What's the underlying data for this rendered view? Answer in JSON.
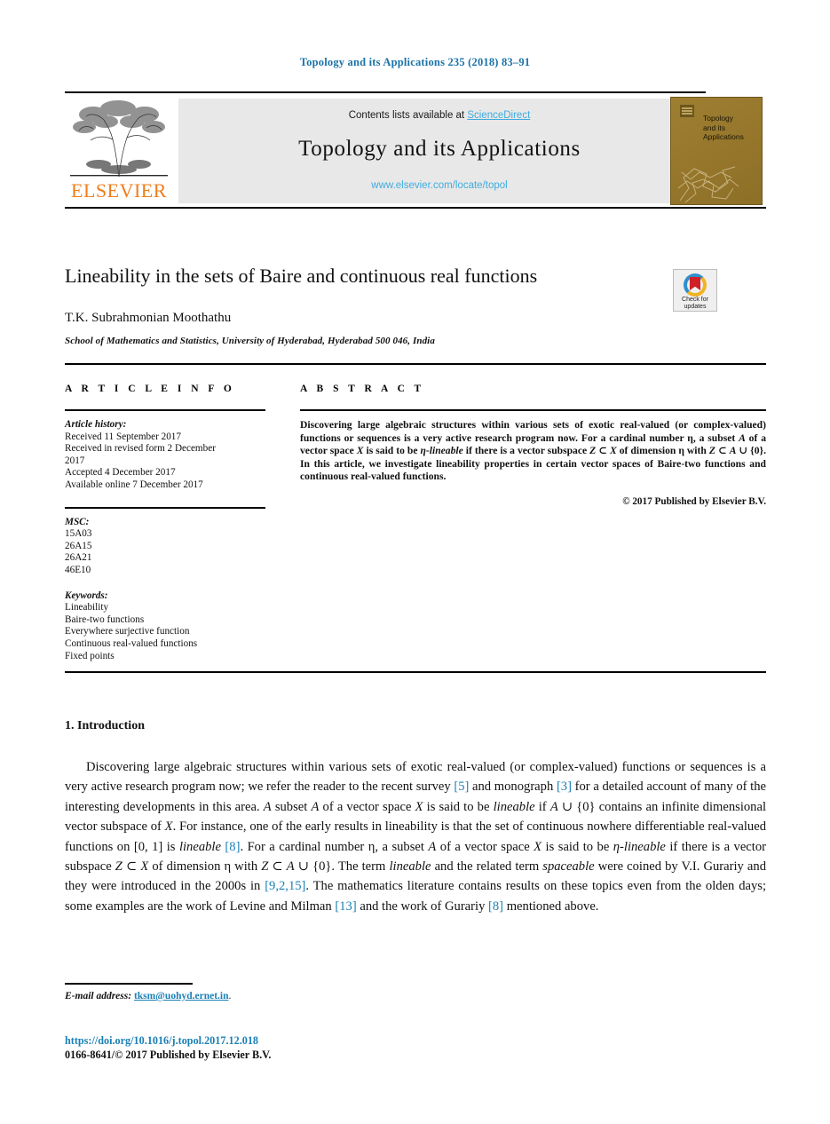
{
  "running_head": "Topology and its Applications 235 (2018) 83–91",
  "masthead": {
    "contents_prefix": "Contents lists available at ",
    "sciencedirect_label": "ScienceDirect",
    "journal_title": "Topology and its Applications",
    "journal_url": "www.elsevier.com/locate/topol",
    "publisher_word": "ELSEVIER",
    "cover_title_lines": [
      "Topology",
      "and its",
      "Applications"
    ]
  },
  "article": {
    "title": "Lineability in the sets of Baire and continuous real functions",
    "author": "T.K. Subrahmonian Moothathu",
    "affiliation": "School of Mathematics and Statistics, University of Hyderabad, Hyderabad 500 046, India",
    "crossmark_label_line1": "Check for",
    "crossmark_label_line2": "updates"
  },
  "info": {
    "heading": "A R T I C L E   I N F O",
    "history_label": "Article history:",
    "history_lines": [
      "Received 11 September 2017",
      "Received in revised form 2 December",
      "2017",
      "Accepted 4 December 2017",
      "Available online 7 December 2017"
    ],
    "msc_label": "MSC:",
    "msc_codes": [
      "15A03",
      "26A15",
      "26A21",
      "46E10"
    ],
    "keywords_label": "Keywords:",
    "keywords": [
      "Lineability",
      "Baire-two functions",
      "Everywhere surjective function",
      "Continuous real-valued functions",
      "Fixed points"
    ]
  },
  "abstract": {
    "heading": "A B S T R A C T",
    "text": "Discovering large algebraic structures within various sets of exotic real-valued (or complex-valued) functions or sequences is a very active research program now. For a cardinal number η, a subset A of a vector space X is said to be η-lineable if there is a vector subspace Z ⊂ X of dimension η with Z ⊂ A ∪ {0}. In this article, we investigate lineability properties in certain vector spaces of Baire-two functions and continuous real-valued functions.",
    "copyright": "© 2017 Published by Elsevier B.V."
  },
  "body": {
    "section_heading": "1. Introduction",
    "paragraph": "Discovering large algebraic structures within various sets of exotic real-valued (or complex-valued) functions or sequences is a very active research program now; we refer the reader to the recent survey [5] and monograph [3] for a detailed account of many of the interesting developments in this area. A subset A of a vector space X is said to be lineable if A ∪ {0} contains an infinite dimensional vector subspace of X. For instance, one of the early results in lineability is that the set of continuous nowhere differentiable real-valued functions on [0, 1] is lineable [8]. For a cardinal number η, a subset A of a vector space X is said to be η-lineable if there is a vector subspace Z ⊂ X of dimension η with Z ⊂ A ∪ {0}. The term lineable and the related term spaceable were coined by V.I. Gurariy and they were introduced in the 2000s in [9,2,15]. The mathematics literature contains results on these topics even from the olden days; some examples are the work of Levine and Milman [13] and the work of Gurariy [8] mentioned above.",
    "references_cited": [
      "5",
      "3",
      "8",
      "9,2,15",
      "13",
      "8"
    ]
  },
  "footer": {
    "email_label": "E-mail address:",
    "email": "tksm@uohyd.ernet.in",
    "email_suffix": ".",
    "doi": "https://doi.org/10.1016/j.topol.2017.12.018",
    "issn_line": "0166-8641/© 2017 Published by Elsevier B.V."
  },
  "colors": {
    "link_blue": "#1a7fb5",
    "sciencedirect_blue": "#3fabdd",
    "elsevier_orange": "#ef7d1a",
    "cover_gold": "#95762b"
  }
}
